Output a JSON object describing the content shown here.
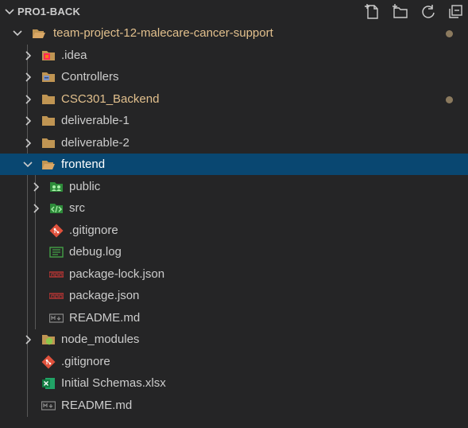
{
  "explorer": {
    "title": "PRO1-BACK",
    "actions": [
      "new-file-icon",
      "new-folder-icon",
      "refresh-icon",
      "collapse-all-icon"
    ]
  },
  "tree": {
    "root": {
      "label": "team-project-12-malecare-cancer-support",
      "expanded": true,
      "modified": true
    },
    "idea": {
      "label": ".idea"
    },
    "controllers": {
      "label": "Controllers"
    },
    "csc301": {
      "label": "CSC301_Backend",
      "modified": true
    },
    "deliverable1": {
      "label": "deliverable-1"
    },
    "deliverable2": {
      "label": "deliverable-2"
    },
    "frontend": {
      "label": "frontend",
      "expanded": true,
      "selected": true
    },
    "public": {
      "label": "public"
    },
    "src": {
      "label": "src"
    },
    "fe_gitignore": {
      "label": ".gitignore"
    },
    "debuglog": {
      "label": "debug.log"
    },
    "packagelock": {
      "label": "package-lock.json"
    },
    "packagejson": {
      "label": "package.json"
    },
    "fe_readme": {
      "label": "README.md"
    },
    "node_modules": {
      "label": "node_modules"
    },
    "gitignore": {
      "label": ".gitignore"
    },
    "schemas": {
      "label": "Initial Schemas.xlsx"
    },
    "readme": {
      "label": "README.md"
    }
  },
  "colors": {
    "background": "#252526",
    "selection": "#094771",
    "modified_text": "#e2c08d",
    "folder": "#c09553"
  }
}
